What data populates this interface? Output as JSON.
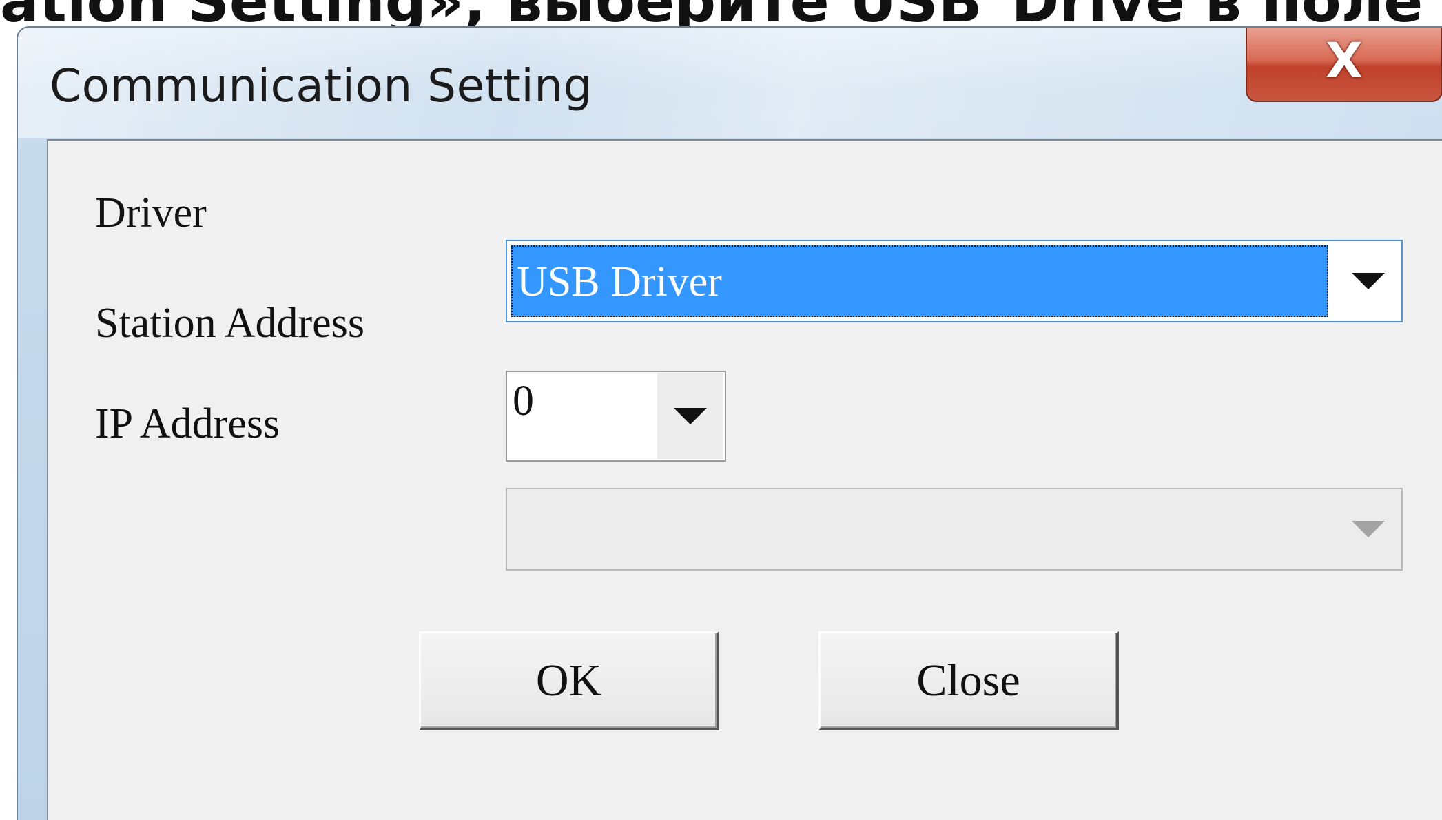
{
  "document": {
    "top_text": "ation Setting», выберите USB_Drive в поле"
  },
  "window": {
    "title": "Communication Setting",
    "close_glyph": "X"
  },
  "form": {
    "driver_label": "Driver",
    "driver_value": "USB Driver",
    "station_label": "Station Address",
    "station_value": "0",
    "ip_label": "IP Address",
    "ip_value": ""
  },
  "buttons": {
    "ok_label": "OK",
    "close_label": "Close"
  },
  "colors": {
    "selection": "#3397ff",
    "close_button": "#c9563f",
    "client_bg": "#f0f0f0"
  }
}
